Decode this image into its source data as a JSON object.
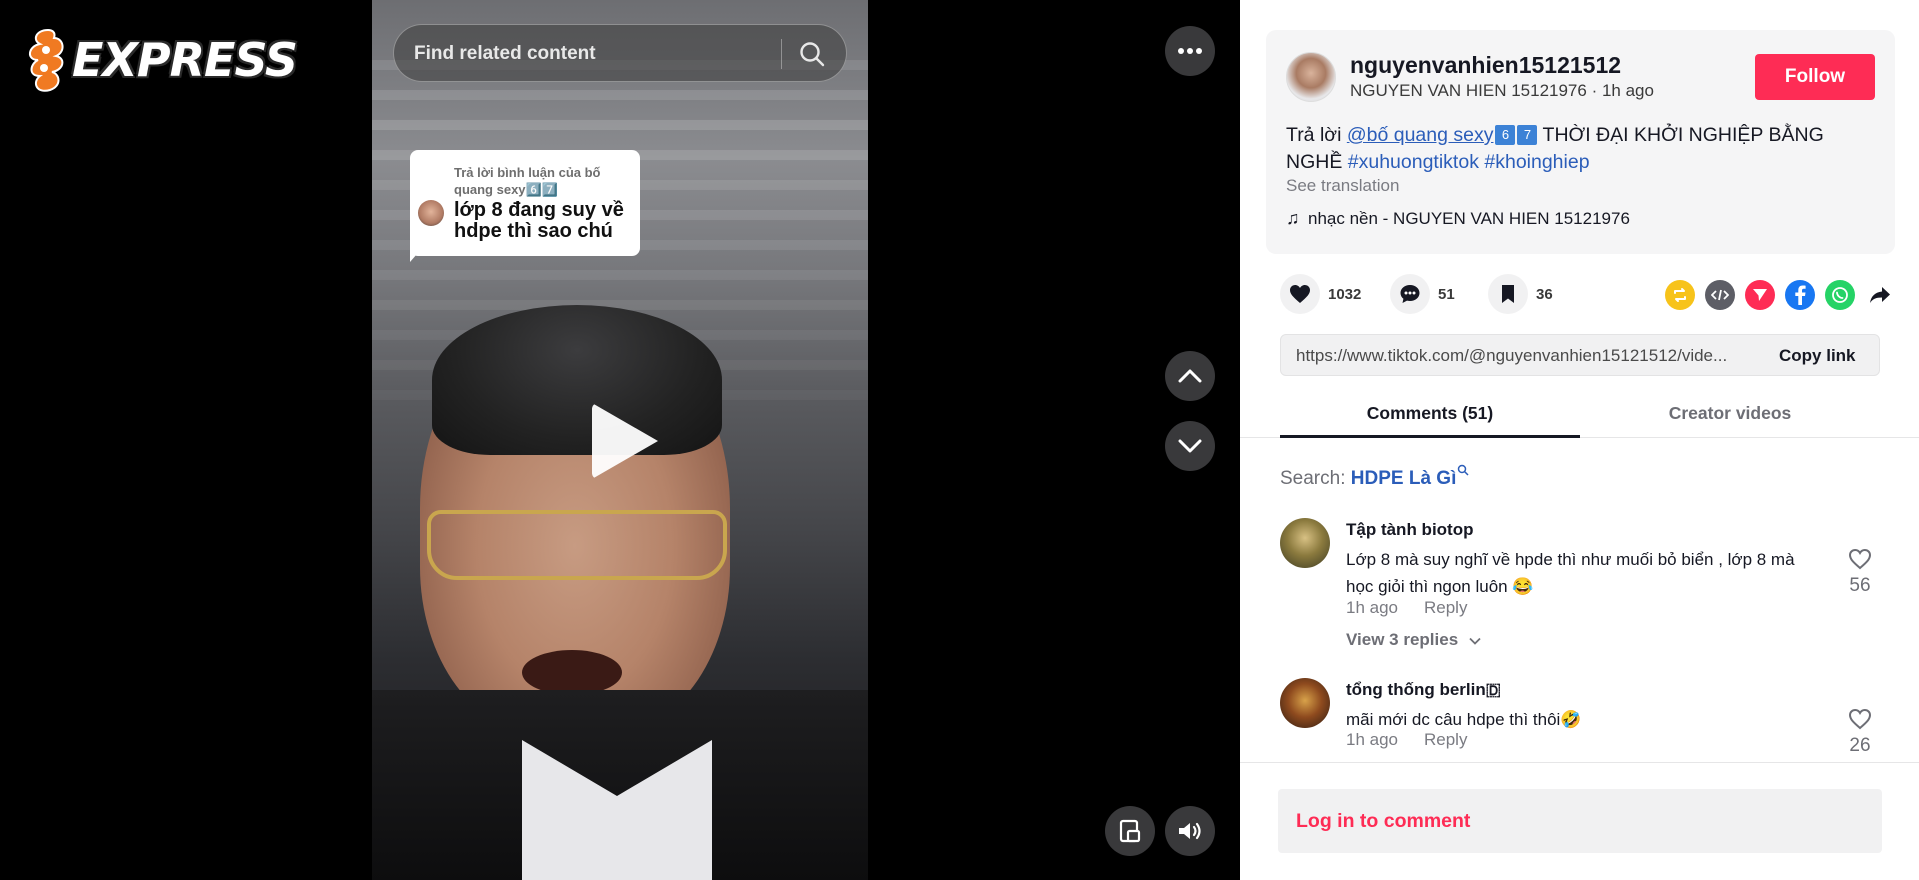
{
  "logo": {
    "text": "EXPRESS",
    "accent": "#f07a22"
  },
  "search": {
    "placeholder": "Find related content"
  },
  "video": {
    "sticker_small": "Trả lời bình luận của bố quang sexy6️⃣7️⃣",
    "sticker_big": "lớp 8 đang suy về hdpe thì sao chú"
  },
  "author": {
    "username": "nguyenvanhien15121512",
    "display_name": "NGUYEN VAN HIEN 15121976",
    "time": "1h ago",
    "separator": " · ",
    "follow_label": "Follow"
  },
  "description": {
    "reply_prefix": "Trả lời ",
    "mention": "@bố quang sexy",
    "emoji_6": "6",
    "emoji_7": "7",
    "text": " THỜI ĐẠI KHỞI NGHIỆP BẰNG NGHỀ ",
    "tag1": "#xuhuongtiktok",
    "tag2": "#khoinghiep",
    "see_translation": "See translation",
    "music": "nhạc nền - NGUYEN VAN HIEN 15121976"
  },
  "stats": {
    "likes": "1032",
    "comments": "51",
    "saves": "36"
  },
  "share_icons": [
    "repost-icon",
    "embed-icon",
    "send-icon",
    "facebook-icon",
    "whatsapp-icon",
    "share-arrow-icon"
  ],
  "link": {
    "url": "https://www.tiktok.com/@nguyenvanhien15121512/vide...",
    "copy_label": "Copy link"
  },
  "tabs": [
    {
      "label": "Comments (51)",
      "active": true
    },
    {
      "label": "Creator videos",
      "active": false
    }
  ],
  "comment_search": {
    "prefix": "Search: ",
    "term": "HDPE Là Gì"
  },
  "comments": [
    {
      "name": "Tập tành biotop",
      "text": "Lớp 8 mà suy nghĩ về hpde thì như muối bỏ biển , lớp 8 mà học giỏi thì ngon luôn 😂",
      "time": "1h ago",
      "reply_label": "Reply",
      "likes": "56",
      "view_replies": "View 3 replies"
    },
    {
      "name": "tổng thống berlin🇩",
      "text": "mãi mới dc câu hdpe thì thôi🤣",
      "time": "1h ago",
      "reply_label": "Reply",
      "likes": "26"
    }
  ],
  "login": {
    "label": "Log in to comment"
  },
  "colors": {
    "brand_red": "#fe2c55",
    "link_blue": "#2b5db9"
  }
}
